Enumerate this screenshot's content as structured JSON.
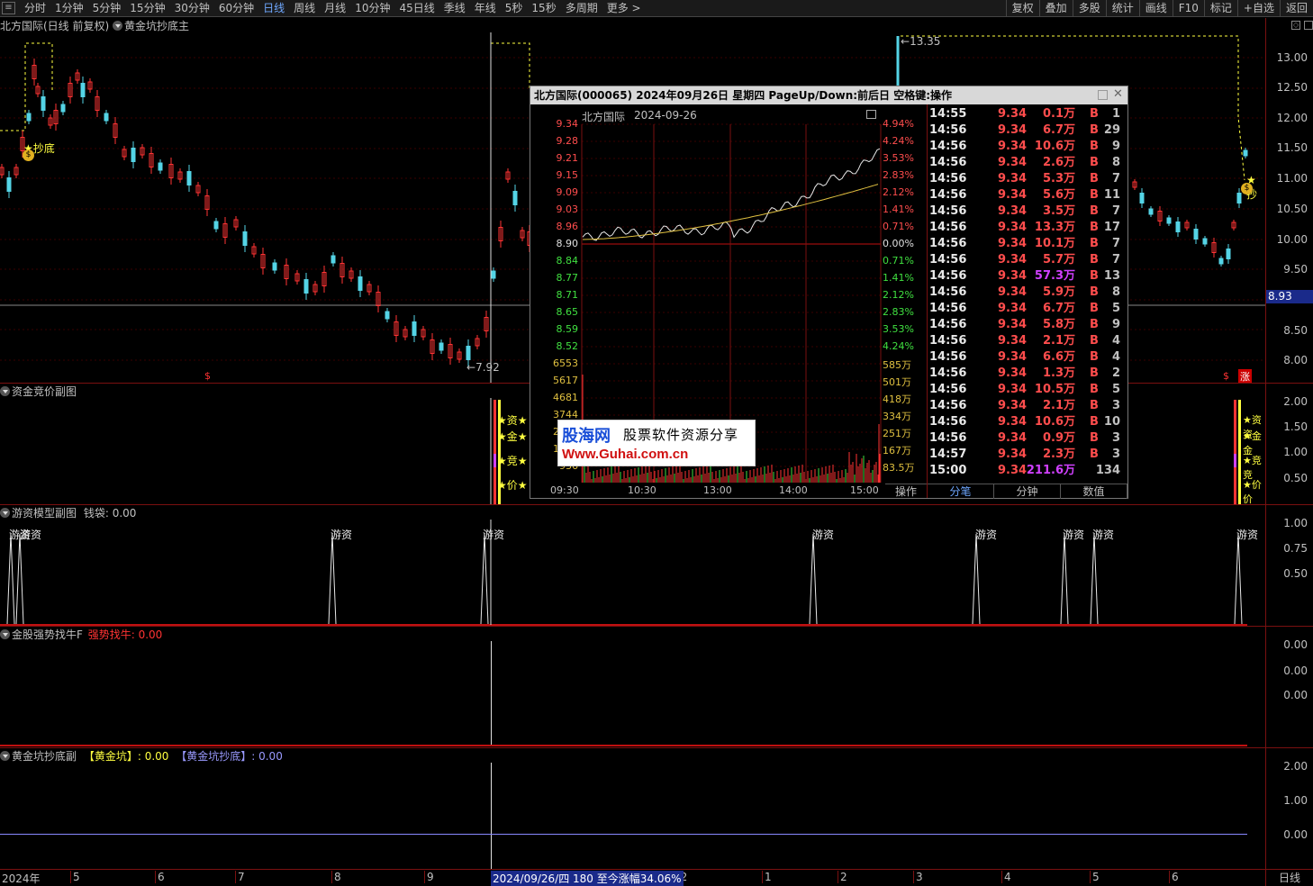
{
  "toolbar": {
    "menu_icon": "menu-icon",
    "timeframes": [
      "分时",
      "1分钟",
      "5分钟",
      "15分钟",
      "30分钟",
      "60分钟",
      "日线",
      "周线",
      "月线",
      "10分钟",
      "45日线",
      "季线",
      "年线",
      "5秒",
      "15秒",
      "多周期",
      "更多 >"
    ],
    "active_timeframe": "日线",
    "right_buttons": [
      "复权",
      "叠加",
      "多股",
      "统计",
      "画线",
      "F10",
      "标记",
      "+自选",
      "返回"
    ]
  },
  "main_panel": {
    "title": "北方国际(日线 前复权)",
    "indicator": "黄金坑抄底主",
    "y_ticks": [
      "13.00",
      "12.50",
      "12.00",
      "11.50",
      "11.00",
      "10.50",
      "10.00",
      "9.50",
      "9.00",
      "8.50",
      "8.00"
    ],
    "price_tag": "8.93",
    "high_label": "13.35",
    "low_label": "7.92",
    "signal_left": "抄底",
    "signal_right": "抄",
    "marker_s": "$",
    "marker_zhang": "涨"
  },
  "sub1": {
    "title": "资金竞价副图",
    "y_ticks": [
      "2.00",
      "1.50",
      "1.00",
      "0.50"
    ],
    "labels": [
      "资",
      "金",
      "竞",
      "价"
    ],
    "right_labels": [
      "资资",
      "金金",
      "竞竞",
      "价价"
    ]
  },
  "sub2": {
    "title": "游资模型副图",
    "stat_label": "钱袋: 0.00",
    "y_ticks": [
      "1.00",
      "0.75",
      "0.50"
    ],
    "spike_label": "游资"
  },
  "sub3": {
    "title": "金股强势找牛F",
    "stat_label": "强势找牛: 0.00",
    "y_ticks": [
      "0.00",
      "0.00",
      "0.00"
    ]
  },
  "sub4": {
    "title": "黄金坑抄底副",
    "stat_a": "【黄金坑】: 0.00",
    "stat_b": "【黄金坑抄底】: 0.00",
    "y_ticks": [
      "2.00",
      "1.00",
      "0.00"
    ]
  },
  "x_axis": {
    "year": "2024年",
    "months": [
      "5",
      "6",
      "7",
      "8",
      "9",
      "12",
      "1",
      "2",
      "3",
      "4",
      "5",
      "6"
    ],
    "cursor_info": "2024/09/26/四 180 至今涨幅34.06%",
    "period": "日线"
  },
  "popup": {
    "title": "北方国际(000065)  2024年09月26日 星期四 PageUp/Down:前后日 空格键:操作",
    "inner_title": "北方国际",
    "inner_date": "2024-09-26",
    "price_ticks": [
      "9.34",
      "9.28",
      "9.21",
      "9.15",
      "9.09",
      "9.03",
      "8.96",
      "8.90",
      "8.84",
      "8.77",
      "8.71",
      "8.65",
      "8.59",
      "8.52"
    ],
    "pct_ticks": [
      "4.94%",
      "4.24%",
      "3.53%",
      "2.83%",
      "2.12%",
      "1.41%",
      "0.71%",
      "0.00%",
      "0.71%",
      "1.41%",
      "2.12%",
      "2.83%",
      "3.53%",
      "4.24%"
    ],
    "vol_ticks_left": [
      "6553",
      "5617",
      "4681",
      "3744",
      "2808",
      "1872",
      "936"
    ],
    "vol_ticks_right": [
      "585万",
      "501万",
      "418万",
      "334万",
      "251万",
      "167万",
      "83.5万"
    ],
    "time_ticks": [
      "09:30",
      "10:30",
      "13:00",
      "14:00",
      "15:00"
    ],
    "op_label": "操作",
    "tabs": [
      "分笔",
      "分钟",
      "数值"
    ],
    "active_tab": "分笔",
    "trades": [
      {
        "time": "14:55",
        "price": "9.34",
        "vol": "0.1万",
        "side": "B",
        "cnt": "1"
      },
      {
        "time": "14:56",
        "price": "9.34",
        "vol": "6.7万",
        "side": "B",
        "cnt": "29"
      },
      {
        "time": "14:56",
        "price": "9.34",
        "vol": "10.6万",
        "side": "B",
        "cnt": "9"
      },
      {
        "time": "14:56",
        "price": "9.34",
        "vol": "2.6万",
        "side": "B",
        "cnt": "8"
      },
      {
        "time": "14:56",
        "price": "9.34",
        "vol": "5.3万",
        "side": "B",
        "cnt": "7"
      },
      {
        "time": "14:56",
        "price": "9.34",
        "vol": "5.6万",
        "side": "B",
        "cnt": "11"
      },
      {
        "time": "14:56",
        "price": "9.34",
        "vol": "3.5万",
        "side": "B",
        "cnt": "7"
      },
      {
        "time": "14:56",
        "price": "9.34",
        "vol": "13.3万",
        "side": "B",
        "cnt": "17"
      },
      {
        "time": "14:56",
        "price": "9.34",
        "vol": "10.1万",
        "side": "B",
        "cnt": "7"
      },
      {
        "time": "14:56",
        "price": "9.34",
        "vol": "5.7万",
        "side": "B",
        "cnt": "7"
      },
      {
        "time": "14:56",
        "price": "9.34",
        "vol": "57.3万",
        "side": "B",
        "cnt": "13"
      },
      {
        "time": "14:56",
        "price": "9.34",
        "vol": "5.9万",
        "side": "B",
        "cnt": "8"
      },
      {
        "time": "14:56",
        "price": "9.34",
        "vol": "6.7万",
        "side": "B",
        "cnt": "5"
      },
      {
        "time": "14:56",
        "price": "9.34",
        "vol": "5.8万",
        "side": "B",
        "cnt": "9"
      },
      {
        "time": "14:56",
        "price": "9.34",
        "vol": "2.1万",
        "side": "B",
        "cnt": "4"
      },
      {
        "time": "14:56",
        "price": "9.34",
        "vol": "6.6万",
        "side": "B",
        "cnt": "4"
      },
      {
        "time": "14:56",
        "price": "9.34",
        "vol": "1.3万",
        "side": "B",
        "cnt": "2"
      },
      {
        "time": "14:56",
        "price": "9.34",
        "vol": "10.5万",
        "side": "B",
        "cnt": "5"
      },
      {
        "time": "14:56",
        "price": "9.34",
        "vol": "2.1万",
        "side": "B",
        "cnt": "3"
      },
      {
        "time": "14:56",
        "price": "9.34",
        "vol": "10.6万",
        "side": "B",
        "cnt": "10"
      },
      {
        "time": "14:56",
        "price": "9.34",
        "vol": "0.9万",
        "side": "B",
        "cnt": "3"
      },
      {
        "time": "14:57",
        "price": "9.34",
        "vol": "2.3万",
        "side": "B",
        "cnt": "3"
      },
      {
        "time": "15:00",
        "price": "9.34",
        "vol": "211.6万",
        "side": "",
        "cnt": "134"
      }
    ]
  },
  "watermark": {
    "brand": "股海网",
    "slogan": "股票软件资源分享",
    "url": "Www.Guhai.com.cn"
  },
  "colors": {
    "up": "#ff3333",
    "down": "#54d4e6",
    "avg_line": "#e0c040",
    "grid": "#3a0000",
    "panel_border": "#7a1010"
  }
}
